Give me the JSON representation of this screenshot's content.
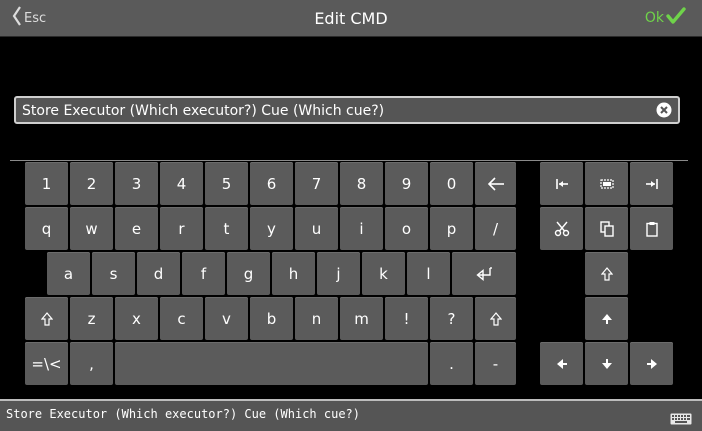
{
  "header": {
    "esc_label": "Esc",
    "title": "Edit CMD",
    "ok_label": "Ok",
    "ok_color": "#6fd34a"
  },
  "input": {
    "value": "Store Executor (Which executor?) Cue (Which cue?)"
  },
  "keyboard": {
    "row1": [
      "1",
      "2",
      "3",
      "4",
      "5",
      "6",
      "7",
      "8",
      "9",
      "0"
    ],
    "row2": [
      "q",
      "w",
      "e",
      "r",
      "t",
      "y",
      "u",
      "i",
      "o",
      "p",
      "/"
    ],
    "row3": [
      "a",
      "s",
      "d",
      "f",
      "g",
      "h",
      "j",
      "k",
      "l"
    ],
    "row4": [
      "z",
      "x",
      "c",
      "v",
      "b",
      "n",
      "m",
      "!",
      "?"
    ],
    "row5": {
      "special": "=\\<",
      "comma": ",",
      "period": ".",
      "dash": "-"
    }
  },
  "command_line": {
    "text": "Store Executor (Which executor?) Cue (Which cue?)"
  },
  "colors": {
    "titlebar": "#5a5a5a",
    "key": "#5b5b5b",
    "background": "#000000"
  }
}
